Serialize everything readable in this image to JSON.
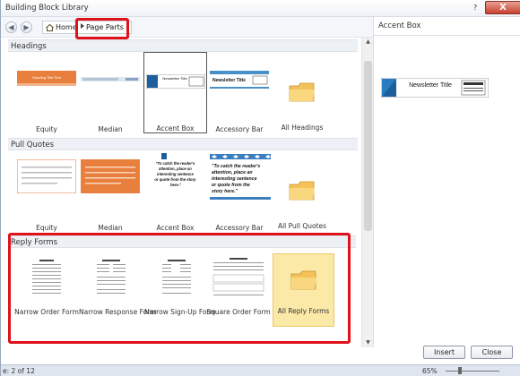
{
  "window": {
    "title": "Building Block Library",
    "help": "?",
    "close": "X"
  },
  "nav": {
    "back": "◀",
    "forward": "▶",
    "home": "Home",
    "crumb": "Page Parts"
  },
  "sections": {
    "headings": {
      "label": "Headings",
      "items": [
        {
          "label": "Equity",
          "thumb_text": "Heading Title Text"
        },
        {
          "label": "Median"
        },
        {
          "label": "Accent Box",
          "thumb_text": "Newsletter Title"
        },
        {
          "label": "Accessory Bar",
          "thumb_text": "Newsletter Title"
        },
        {
          "label": "All Headings"
        }
      ]
    },
    "pullquotes": {
      "label": "Pull Quotes",
      "items": [
        {
          "label": "Equity"
        },
        {
          "label": "Median"
        },
        {
          "label": "Accent Box",
          "thumb_text": "\"To catch the reader's attention, place an interesting sentence or quote from the story here.\""
        },
        {
          "label": "Accessory Bar",
          "thumb_text": "\"To catch the reader's attention, place an interesting sentence or quote from the story here.\""
        },
        {
          "label": "All Pull Quotes"
        }
      ]
    },
    "replyforms": {
      "label": "Reply Forms",
      "items": [
        {
          "label": "Narrow Order Form"
        },
        {
          "label": "Narrow Response Form"
        },
        {
          "label": "Narrow Sign-Up Form"
        },
        {
          "label": "Square Order Form"
        },
        {
          "label": "All Reply Forms"
        }
      ]
    }
  },
  "preview": {
    "title": "Accent Box",
    "newsletter": "Newsletter Title"
  },
  "buttons": {
    "insert": "Insert",
    "close": "Close"
  },
  "statusbar": {
    "page": "e: 2 of 12",
    "zoom": "65%"
  },
  "colors": {
    "highlight": "#e0111a",
    "selected_folder": "#fbe9a8",
    "equity_orange": "#e97f3d",
    "accent_blue": "#1d5f9c"
  }
}
